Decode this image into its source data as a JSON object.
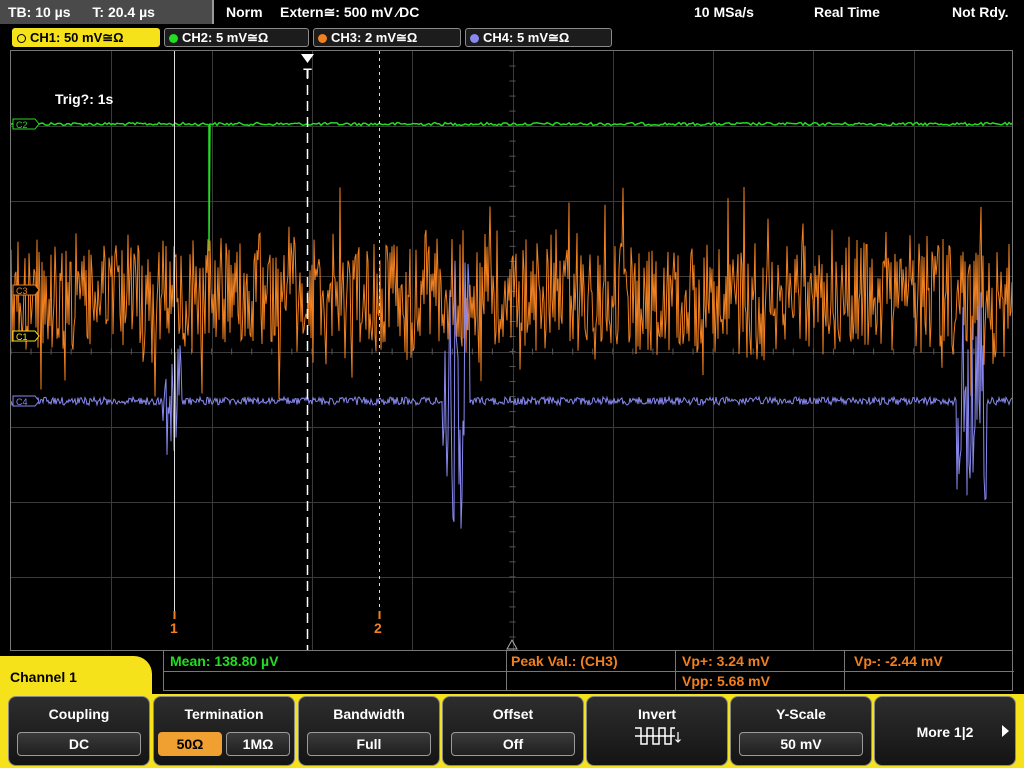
{
  "topbar": {
    "timebase": "TB: 10 µs",
    "trigger_time": "T: 20.4 µs",
    "trigger_mode": "Norm",
    "trigger_source": "Extern≅: 500 mV ⁄DC",
    "sample_rate": "10 MSa/s",
    "acquisition": "Real Time",
    "status": "Not Rdy."
  },
  "channels": [
    {
      "label": "CH1: 50 mV≅Ω",
      "color": "#f5e21b",
      "active": true
    },
    {
      "label": "CH2: 5 mV≅Ω",
      "color": "#22dd22",
      "active": false
    },
    {
      "label": "CH3: 2 mV≅Ω",
      "color": "#f08020",
      "active": false
    },
    {
      "label": "CH4: 5 mV≅Ω",
      "color": "#8888ee",
      "active": false
    }
  ],
  "screen": {
    "trigger_info": "Trig?: 1s",
    "cursor1_label": "1",
    "cursor2_label": "2",
    "trigger_marker": "T",
    "ch_markers": [
      "C2",
      "C3",
      "C1",
      "C4"
    ]
  },
  "measurements": {
    "mean": "Mean: 138.80 µV",
    "peak_label": "Peak Val.:  (CH3)",
    "vp_plus": "Vp+: 3.24 mV",
    "vp_minus": "Vp-: -2.44 mV",
    "vpp": "Vpp: 5.68 mV",
    "mean_color": "#22dd22",
    "peak_color": "#f08020"
  },
  "menu": {
    "title": "Channel 1",
    "coupling": {
      "title": "Coupling",
      "value": "DC"
    },
    "termination": {
      "title": "Termination",
      "options": [
        "50Ω",
        "1MΩ"
      ],
      "selected": "50Ω"
    },
    "bandwidth": {
      "title": "Bandwidth",
      "value": "Full"
    },
    "offset": {
      "title": "Offset",
      "value": "Off"
    },
    "invert": {
      "title": "Invert",
      "icon": "invert-waveform-icon"
    },
    "yscale": {
      "title": "Y-Scale",
      "value": "50 mV"
    },
    "more": {
      "label": "More 1|2",
      "icon": "arrow-right-icon"
    }
  }
}
